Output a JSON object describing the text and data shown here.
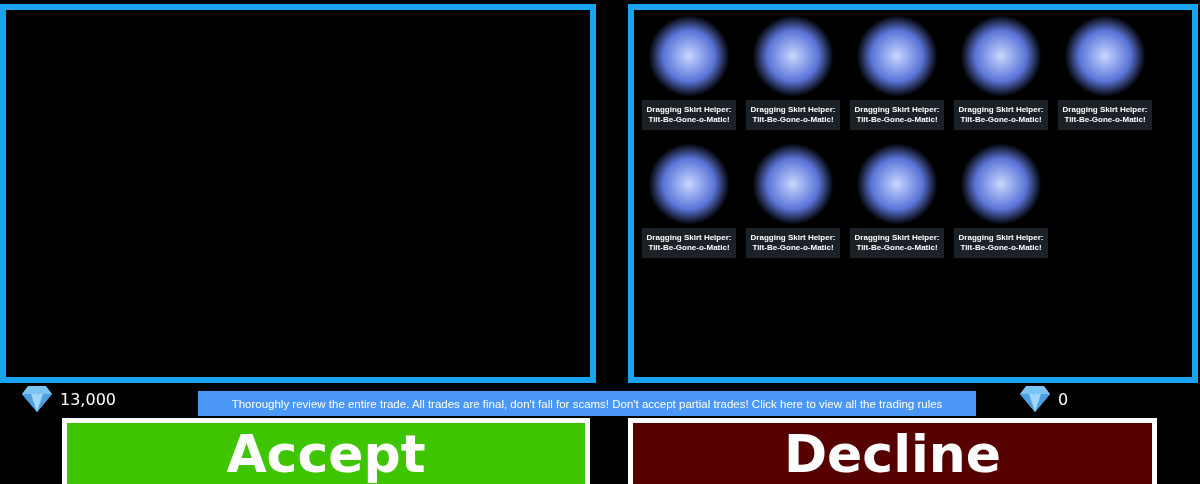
{
  "my_offer": {
    "gems": "13,000"
  },
  "their_offer": {
    "items": [
      {
        "name": "Dragging Skirt Helper: Tilt-Be-Gone-o-Matic!"
      },
      {
        "name": "Dragging Skirt Helper: Tilt-Be-Gone-o-Matic!"
      },
      {
        "name": "Dragging Skirt Helper: Tilt-Be-Gone-o-Matic!"
      },
      {
        "name": "Dragging Skirt Helper: Tilt-Be-Gone-o-Matic!"
      },
      {
        "name": "Dragging Skirt Helper: Tilt-Be-Gone-o-Matic!"
      },
      {
        "name": "Dragging Skirt Helper: Tilt-Be-Gone-o-Matic!"
      },
      {
        "name": "Dragging Skirt Helper: Tilt-Be-Gone-o-Matic!"
      },
      {
        "name": "Dragging Skirt Helper: Tilt-Be-Gone-o-Matic!"
      },
      {
        "name": "Dragging Skirt Helper: Tilt-Be-Gone-o-Matic!"
      }
    ],
    "gems": "0"
  },
  "rules_banner": "Thoroughly review the entire trade. All trades are final, don't fall for scams! Don't accept partial trades! Click here to view all the trading rules",
  "buttons": {
    "accept": "Accept",
    "decline": "Decline"
  }
}
